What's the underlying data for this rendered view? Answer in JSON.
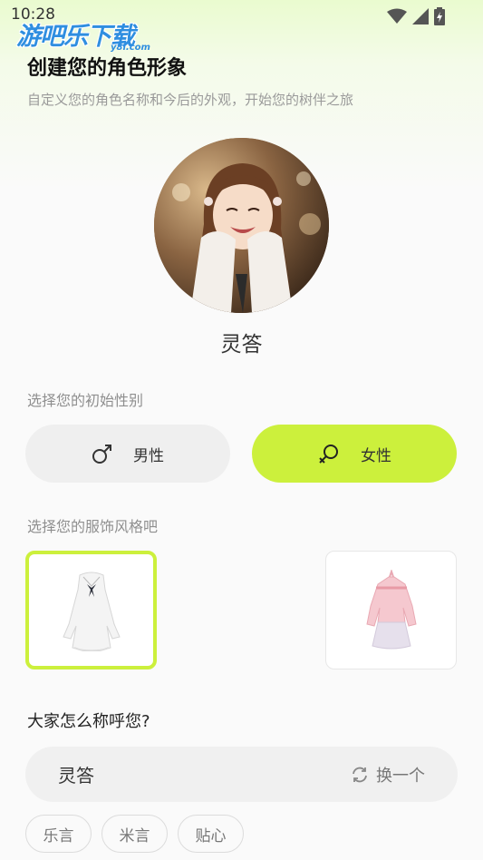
{
  "status_bar": {
    "time": "10:28"
  },
  "watermark": {
    "main": "游吧乐下载",
    "sub": "y8l.com"
  },
  "header": {
    "title": "创建您的角色形象",
    "subtitle": "自定义您的角色名称和今后的外观，开始您的树伴之旅"
  },
  "avatar": {
    "name": "灵答"
  },
  "gender": {
    "label": "选择您的初始性别",
    "options": [
      {
        "label": "男性",
        "icon": "male-icon",
        "selected": false
      },
      {
        "label": "女性",
        "icon": "female-icon",
        "selected": true
      }
    ]
  },
  "outfit": {
    "label": "选择您的服饰风格吧",
    "options": [
      {
        "name": "white-dress",
        "selected": true
      },
      {
        "name": "pink-dress",
        "selected": false
      }
    ]
  },
  "naming": {
    "question": "大家怎么称呼您?",
    "value": "灵答",
    "refresh_label": "换一个",
    "suggestions": [
      "乐言",
      "米言",
      "贴心"
    ]
  },
  "colors": {
    "accent": "#ccf03c",
    "background": "#fafafa"
  }
}
